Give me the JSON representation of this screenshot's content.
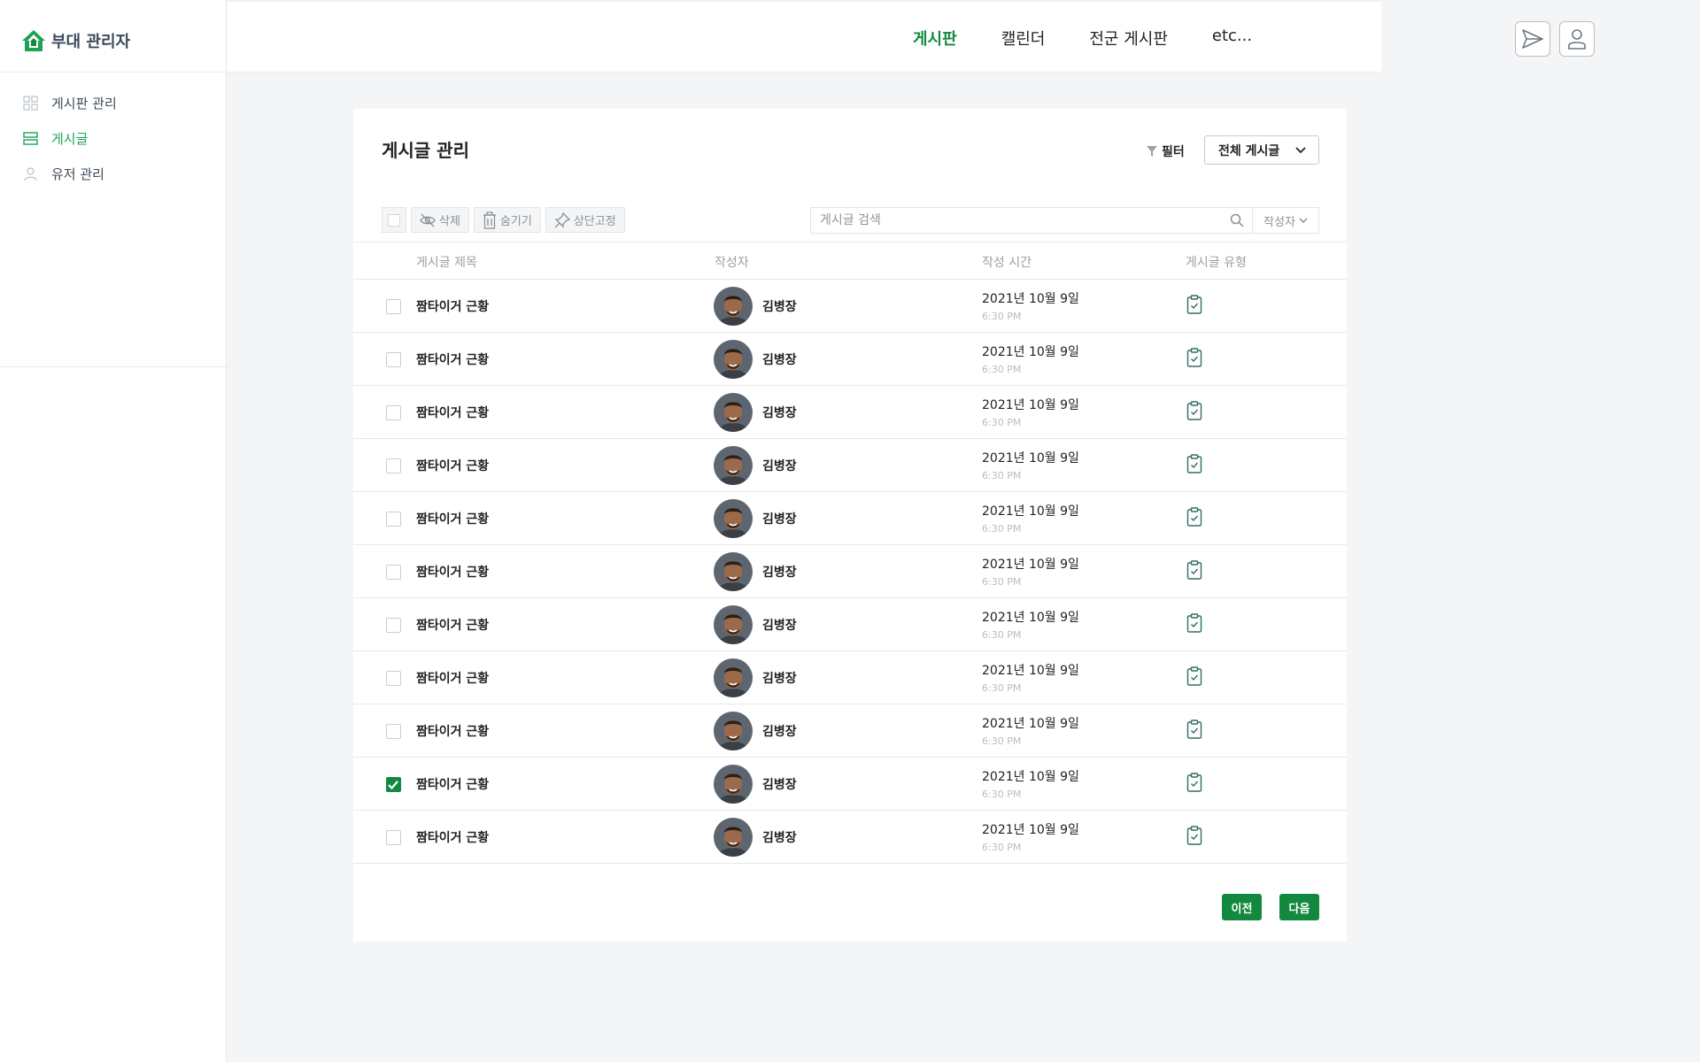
{
  "app": {
    "brand": "부대 관리자"
  },
  "sidebar": {
    "items": [
      {
        "label": "게시판 관리",
        "icon": "grid-icon",
        "active": false
      },
      {
        "label": "게시글",
        "icon": "list-icon",
        "active": true
      },
      {
        "label": "유저 관리",
        "icon": "user-icon",
        "active": false
      }
    ]
  },
  "topnav": {
    "items": [
      {
        "label": "게시판",
        "active": true
      },
      {
        "label": "캘린더",
        "active": false
      },
      {
        "label": "전군 게시판",
        "active": false
      },
      {
        "label": "etc...",
        "active": false
      }
    ],
    "icons": [
      "send-icon",
      "user-profile-icon"
    ]
  },
  "main": {
    "title": "게시글 관리",
    "filter_label": "필터",
    "filter_value": "전체 게시글",
    "toolbar": {
      "delete": "삭제",
      "hide": "숨기기",
      "pin": "상단고정"
    },
    "search": {
      "placeholder": "게시글 검색",
      "author_select": "작성자"
    },
    "columns": {
      "title": "게시글 제목",
      "author": "작성자",
      "time": "작성 시간",
      "type": "게시글 유형"
    },
    "rows": [
      {
        "title": "짬타이거 근황",
        "author": "김병장",
        "date": "2021년 10월 9일",
        "time": "6:30 PM",
        "checked": false
      },
      {
        "title": "짬타이거 근황",
        "author": "김병장",
        "date": "2021년 10월 9일",
        "time": "6:30 PM",
        "checked": false
      },
      {
        "title": "짬타이거 근황",
        "author": "김병장",
        "date": "2021년 10월 9일",
        "time": "6:30 PM",
        "checked": false
      },
      {
        "title": "짬타이거 근황",
        "author": "김병장",
        "date": "2021년 10월 9일",
        "time": "6:30 PM",
        "checked": false
      },
      {
        "title": "짬타이거 근황",
        "author": "김병장",
        "date": "2021년 10월 9일",
        "time": "6:30 PM",
        "checked": false
      },
      {
        "title": "짬타이거 근황",
        "author": "김병장",
        "date": "2021년 10월 9일",
        "time": "6:30 PM",
        "checked": false
      },
      {
        "title": "짬타이거 근황",
        "author": "김병장",
        "date": "2021년 10월 9일",
        "time": "6:30 PM",
        "checked": false
      },
      {
        "title": "짬타이거 근황",
        "author": "김병장",
        "date": "2021년 10월 9일",
        "time": "6:30 PM",
        "checked": false
      },
      {
        "title": "짬타이거 근황",
        "author": "김병장",
        "date": "2021년 10월 9일",
        "time": "6:30 PM",
        "checked": false
      },
      {
        "title": "짬타이거 근황",
        "author": "김병장",
        "date": "2021년 10월 9일",
        "time": "6:30 PM",
        "checked": true
      },
      {
        "title": "짬타이거 근황",
        "author": "김병장",
        "date": "2021년 10월 9일",
        "time": "6:30 PM",
        "checked": false
      }
    ],
    "pager": {
      "prev": "이전",
      "next": "다음"
    }
  },
  "colors": {
    "accent": "#13893f",
    "sidebar_active": "#1ea355",
    "text": "#222222",
    "muted": "#9aa0a6"
  }
}
